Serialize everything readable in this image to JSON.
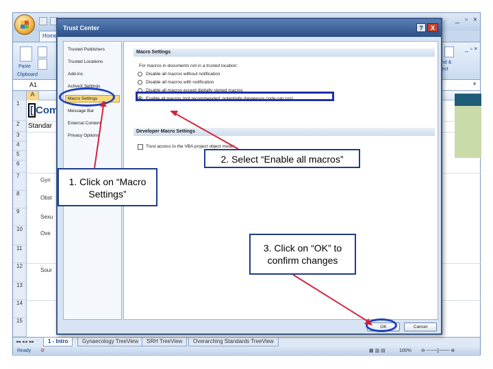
{
  "excel": {
    "home_tab": "Home",
    "ribbon": {
      "paste_label": "Paste",
      "clipboard_label": "Clipboard",
      "find_label": "nd &",
      "select_label": "ect"
    },
    "name_box": "A1",
    "column_a_header": "A",
    "row_numbers": [
      "1",
      "2",
      "3",
      "4",
      "5",
      "6",
      "7",
      "8",
      "9",
      "10",
      "11",
      "12",
      "13",
      "14",
      "15"
    ],
    "cells": {
      "a1_title": "Comm",
      "a1_selected_char": "[",
      "a2_text": "Standar",
      "a7_text": "Gyn",
      "a8_text": "Obst",
      "a9_text": "Sexu",
      "a10_text": "Ove",
      "a12_text": "Sour"
    },
    "sheet_tabs": [
      {
        "label": "1 - Intro",
        "active": true
      },
      {
        "label": "Gynaecology TreeView",
        "active": false
      },
      {
        "label": "SRH TreeView",
        "active": false
      },
      {
        "label": "Overarching Standards TreeView",
        "active": false
      }
    ],
    "status": {
      "ready": "Ready",
      "zoom": "100%"
    }
  },
  "dialog": {
    "title": "Trust Center",
    "help_button": "?",
    "close_button": "X",
    "nav_items": [
      {
        "label": "Trusted Publishers",
        "selected": false
      },
      {
        "label": "Trusted Locations",
        "selected": false
      },
      {
        "label": "Add-ins",
        "selected": false
      },
      {
        "label": "ActiveX Settings",
        "selected": false
      },
      {
        "label": "Macro Settings",
        "selected": true
      },
      {
        "label": "Message Bar",
        "selected": false
      },
      {
        "label": "External Content",
        "selected": false
      },
      {
        "label": "Privacy Options",
        "selected": false
      }
    ],
    "macro_section_title": "Macro Settings",
    "macro_intro": "For macros in documents not in a trusted location:",
    "macro_options": [
      {
        "label": "Disable all macros without notification",
        "checked": false
      },
      {
        "label": "Disable all macros with notification",
        "checked": false
      },
      {
        "label": "Disable all macros except digitally signed macros",
        "checked": false
      },
      {
        "label": "Enable all macros (not recommended; potentially dangerous code can run)",
        "checked": true
      }
    ],
    "developer_section_title": "Developer Macro Settings",
    "developer_option": "Trust access to the VBA project object model",
    "ok_button": "OK",
    "cancel_button": "Cancel"
  },
  "annotations": {
    "step1": "1. Click on “Macro Settings”",
    "step2": "2. Select “Enable all macros”",
    "step3": "3. Click on “OK” to confirm changes",
    "highlight_color": "#1e3fbf",
    "line_color": "#d6213b"
  }
}
